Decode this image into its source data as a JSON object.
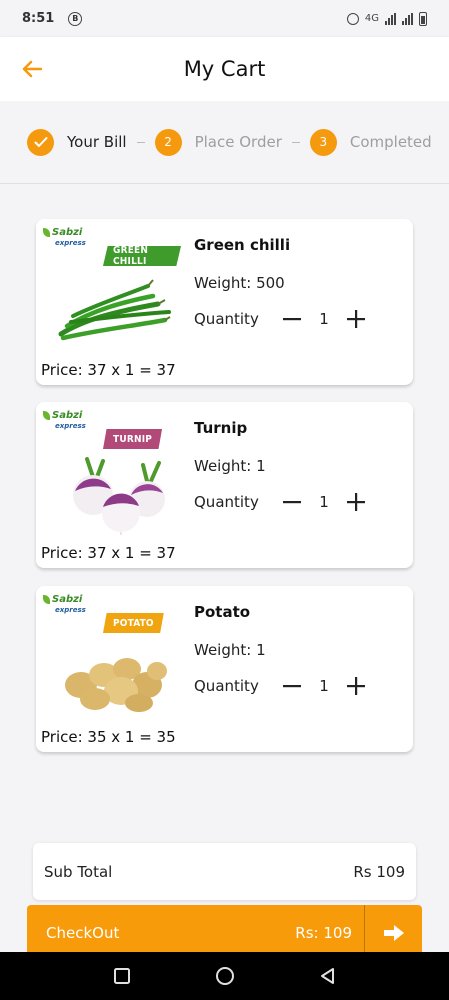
{
  "status_bar": {
    "time": "8:51",
    "msg_icon": "B",
    "network": "4G"
  },
  "header": {
    "title": "My Cart"
  },
  "stepper": {
    "steps": [
      {
        "label": "Your Bill",
        "state": "done"
      },
      {
        "label": "Place Order",
        "number": "2"
      },
      {
        "label": "Completed",
        "number": "3"
      }
    ]
  },
  "cart": {
    "quantity_label": "Quantity",
    "items": [
      {
        "name": "Green chilli",
        "weight": "Weight: 500",
        "quantity": "1",
        "price": "Price: 37 x 1 = 37",
        "tag": "GREEN CHILLI",
        "tag_color": "#3f9b2b",
        "image_icon": "green-chilli-image"
      },
      {
        "name": "Turnip",
        "weight": "Weight: 1",
        "quantity": "1",
        "price": "Price: 37 x 1 = 37",
        "tag": "TURNIP",
        "tag_color": "#b14a78",
        "image_icon": "turnip-image"
      },
      {
        "name": "Potato",
        "weight": "Weight: 1",
        "quantity": "1",
        "price": "Price: 35 x 1 = 35",
        "tag": "POTATO",
        "tag_color": "#f0a410",
        "image_icon": "potato-image"
      }
    ],
    "brand": {
      "name": "Sabzi",
      "sub": "express"
    }
  },
  "subtotal": {
    "label": "Sub Total",
    "value": "Rs 109"
  },
  "checkout": {
    "label": "CheckOut",
    "amount": "Rs: 109"
  },
  "colors": {
    "accent": "#f59a0e",
    "background": "#f4f4f6"
  }
}
